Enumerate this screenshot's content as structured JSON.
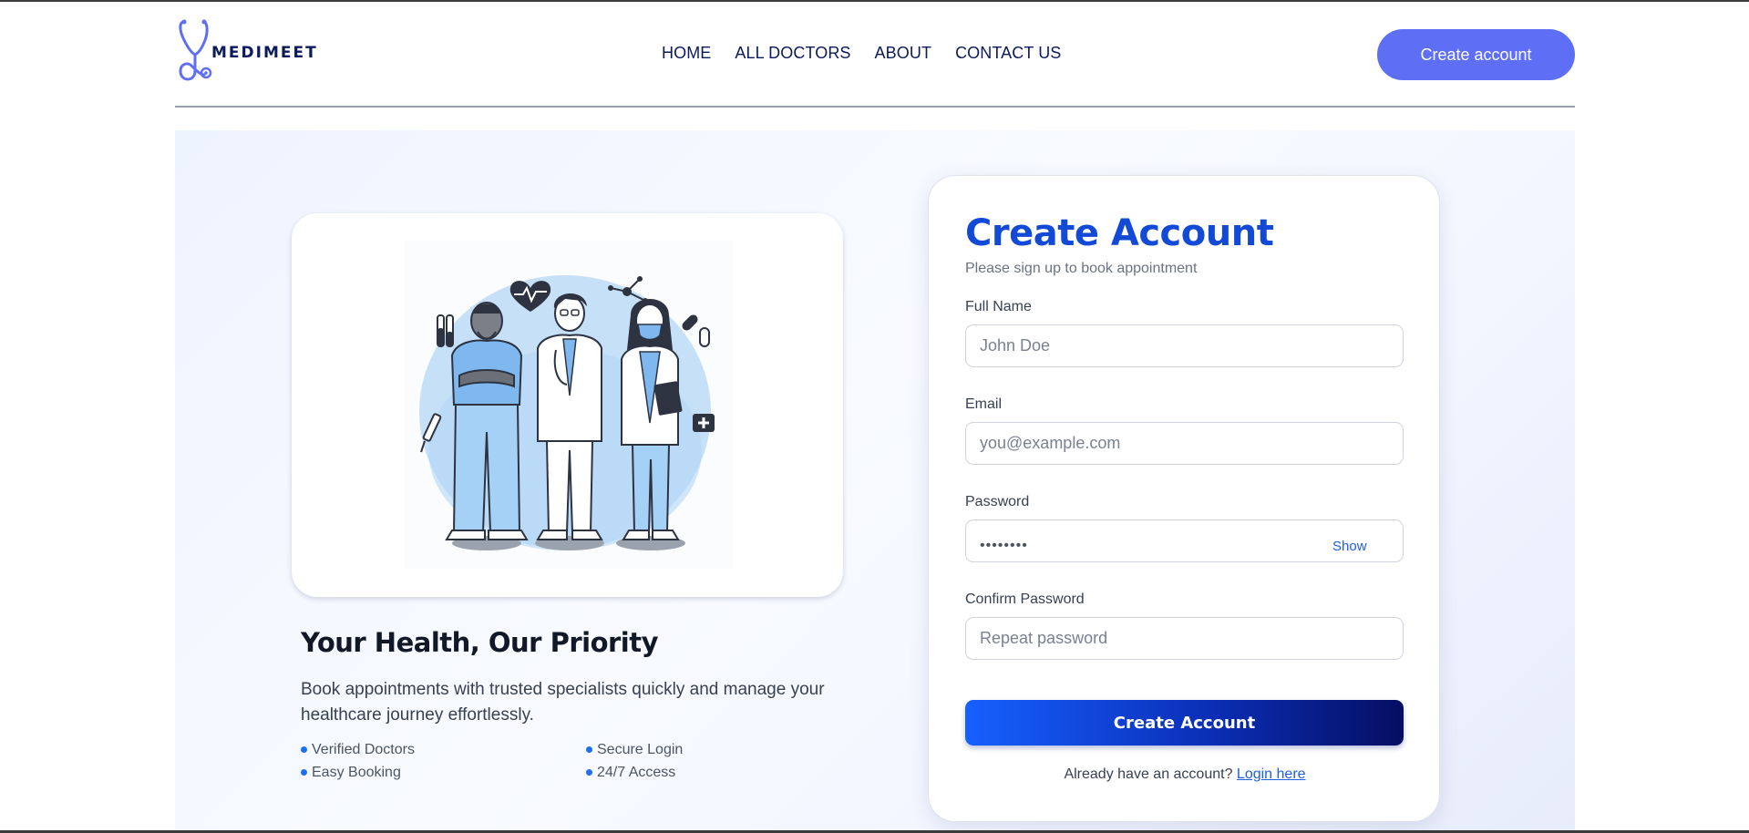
{
  "brand": {
    "name": "MEDIMEET"
  },
  "nav": {
    "items": [
      {
        "label": "HOME"
      },
      {
        "label": "ALL DOCTORS"
      },
      {
        "label": "ABOUT"
      },
      {
        "label": "CONTACT US"
      }
    ],
    "cta_label": "Create account"
  },
  "hero": {
    "title": "Your Health, Our Priority",
    "description": "Book appointments with trusted specialists quickly and manage your healthcare journey effortlessly.",
    "features": [
      {
        "label": "Verified Doctors"
      },
      {
        "label": "Secure Login"
      },
      {
        "label": "Easy Booking"
      },
      {
        "label": "24/7 Access"
      }
    ],
    "illustration_icon": "doctors-illustration-icon"
  },
  "form": {
    "title": "Create Account",
    "subtitle": "Please sign up to book appointment",
    "full_name": {
      "label": "Full Name",
      "placeholder": "John Doe",
      "value": ""
    },
    "email": {
      "label": "Email",
      "placeholder": "you@example.com",
      "value": ""
    },
    "password": {
      "label": "Password",
      "masked_value": "••••••••",
      "show_label": "Show"
    },
    "confirm_password": {
      "label": "Confirm Password",
      "placeholder": "Repeat password",
      "value": ""
    },
    "submit_label": "Create Account",
    "login_prompt": "Already have an account?",
    "login_link": "Login here"
  },
  "colors": {
    "brand_navy": "#0b1a5c",
    "accent_indigo": "#5f6ff5",
    "title_blue": "#1249d6",
    "link_blue": "#1d5fe0",
    "button_gradient_start": "#1660ff",
    "button_gradient_end": "#050e62",
    "illustration_blue": "#a9d0f5"
  }
}
